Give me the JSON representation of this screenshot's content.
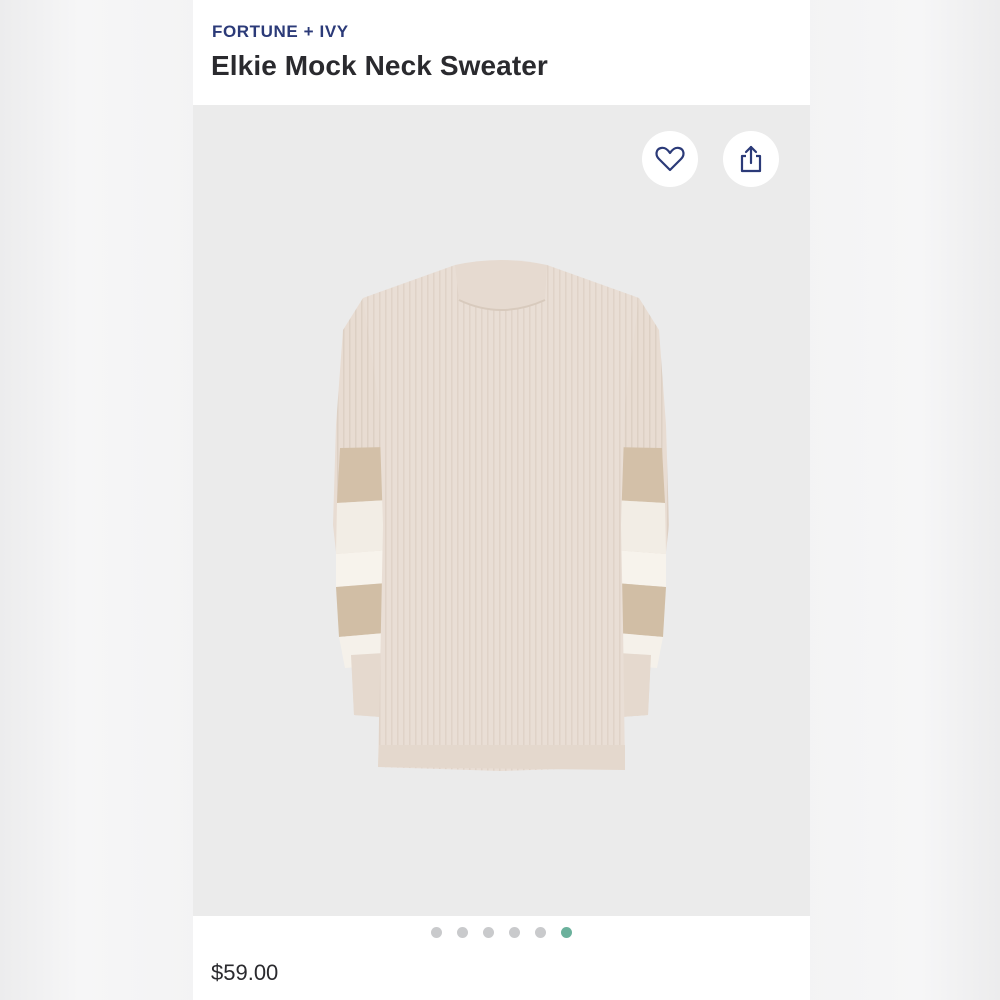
{
  "product": {
    "brand": "FORTUNE + IVY",
    "name": "Elkie Mock Neck Sweater",
    "price": "$59.00"
  },
  "actions": {
    "favorite_icon": "heart-icon",
    "share_icon": "share-icon"
  },
  "carousel": {
    "dot_count": 6,
    "active_index": 5
  },
  "colors": {
    "brand_text": "#2b3a78",
    "active_dot": "#6bb19c",
    "inactive_dot": "#c9cacc",
    "sweater_base": "#e8ddd4",
    "stripe_tan": "#d2bfa6",
    "stripe_cream": "#f5f1ea"
  }
}
